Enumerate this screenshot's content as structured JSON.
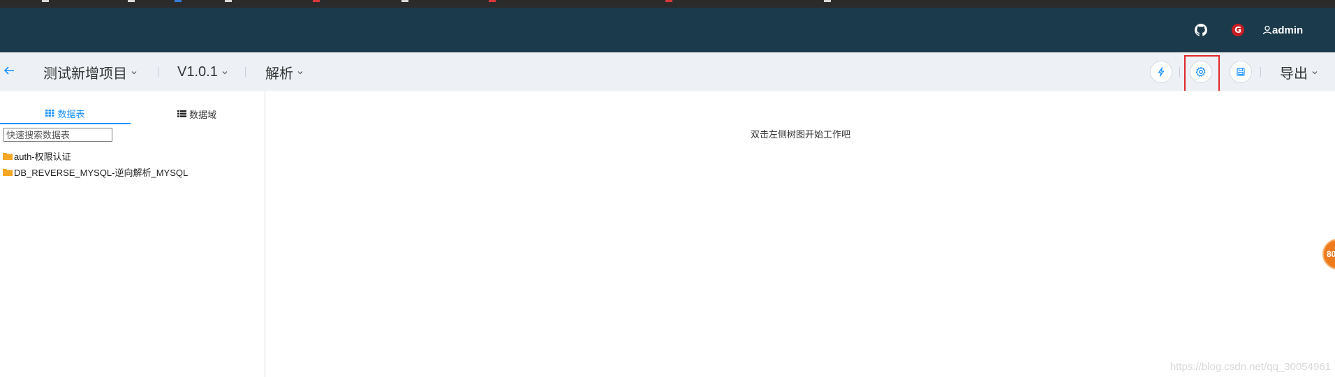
{
  "header": {
    "user_name": "admin"
  },
  "toolbar": {
    "project_name": "测试新增项目",
    "version": "V1.0.1",
    "action_menu": "解析",
    "export_label": "导出"
  },
  "sidebar": {
    "tabs": [
      {
        "label": "数据表",
        "icon": "grid-icon",
        "active": true
      },
      {
        "label": "数据域",
        "icon": "list-icon",
        "active": false
      }
    ],
    "search": {
      "placeholder": "快速搜索数据表",
      "value": ""
    },
    "tree": [
      {
        "label": "auth-权限认证"
      },
      {
        "label": "DB_REVERSE_MYSQL-逆向解析_MYSQL"
      }
    ]
  },
  "main": {
    "empty_hint": "双击左侧树图开始工作吧"
  },
  "watermark": "https://blog.csdn.net/qq_30054961",
  "float_badge": "80",
  "colors": {
    "topbar": "#1b3a4b",
    "toolbar": "#edf1f5",
    "accent": "#1890ff",
    "highlight": "#e0292b",
    "folder": "#f5a623"
  }
}
